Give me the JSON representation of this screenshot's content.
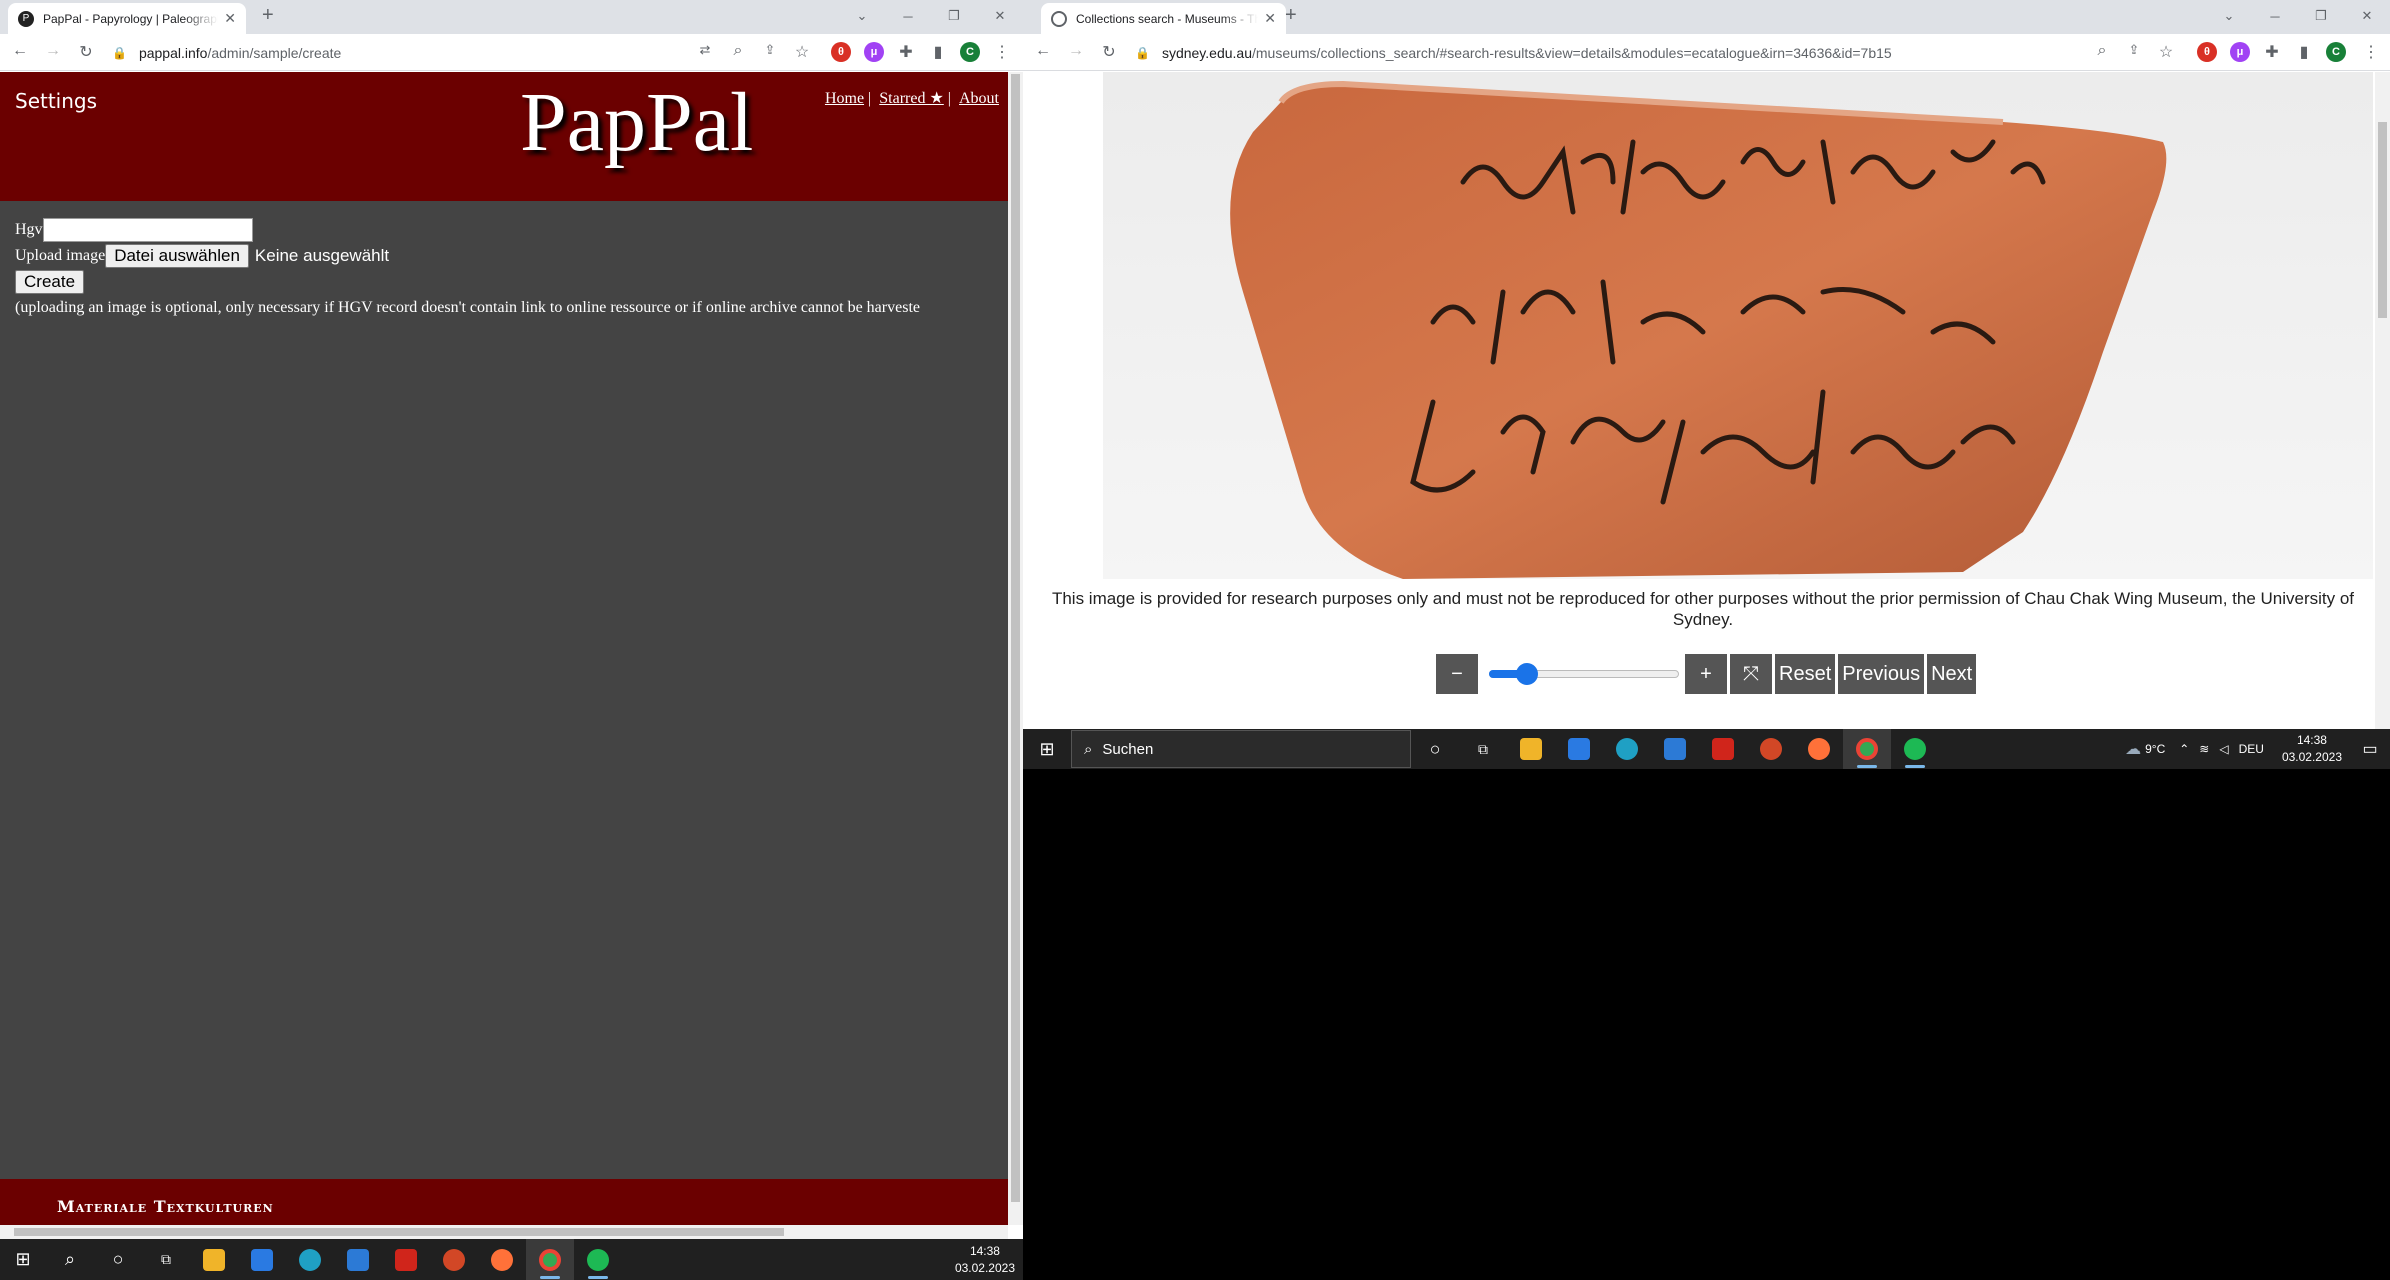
{
  "left_window": {
    "tab_title": "PapPal - Papyrology | Paleography",
    "url_host": "pappal.info",
    "url_path": "/admin/sample/create",
    "page": {
      "settings_label": "Settings",
      "logo_text": "PapPal",
      "nav": {
        "home": "Home",
        "starred": "Starred ★",
        "about": "About",
        "sep": "|"
      },
      "form": {
        "hgv_label": "Hgv",
        "upload_label": "Upload image",
        "choose_file_button": "Datei auswählen",
        "no_file_text": "Keine ausgewählt",
        "create_button": "Create",
        "note": "(uploading an image is optional, only necessary if HGV record doesn't contain link to online ressource or if online archive cannot be harveste"
      },
      "footer_text": "Materiale Textkulturen"
    },
    "taskbar": {
      "clock_time": "14:38",
      "clock_date": "03.02.2023"
    }
  },
  "right_window": {
    "tab_title": "Collections search - Museums - The University of Sydney",
    "url_host": "sydney.edu.au",
    "url_path": "/museums/collections_search/#search-results&view=details&modules=ecatalogue&irn=34636&id=7b15",
    "page": {
      "disclaimer": "This image is provided for research purposes only and must not be reproduced for other purposes without the prior permission of Chau Chak Wing Museum, the University of Sydney.",
      "controls": {
        "zoom_out": "−",
        "zoom_in": "+",
        "fit": "⤧",
        "reset": "Reset",
        "previous": "Previous",
        "next": "Next"
      },
      "zoom_slider_fraction": 0.2
    },
    "taskbar": {
      "search_placeholder": "Suchen",
      "weather": "9°C",
      "language": "DEU",
      "clock_time": "14:38",
      "clock_date": "03.02.2023"
    }
  },
  "icons": [
    "back-icon",
    "forward-icon",
    "reload-icon",
    "lock-icon",
    "star-icon",
    "extensions-icon",
    "windows-start-icon",
    "search-icon",
    "task-view-icon"
  ],
  "colors": {
    "pappal_red": "#6b0000",
    "page_gray": "#444444",
    "slider_blue": "#1a73e8",
    "taskbar": "#202020"
  }
}
